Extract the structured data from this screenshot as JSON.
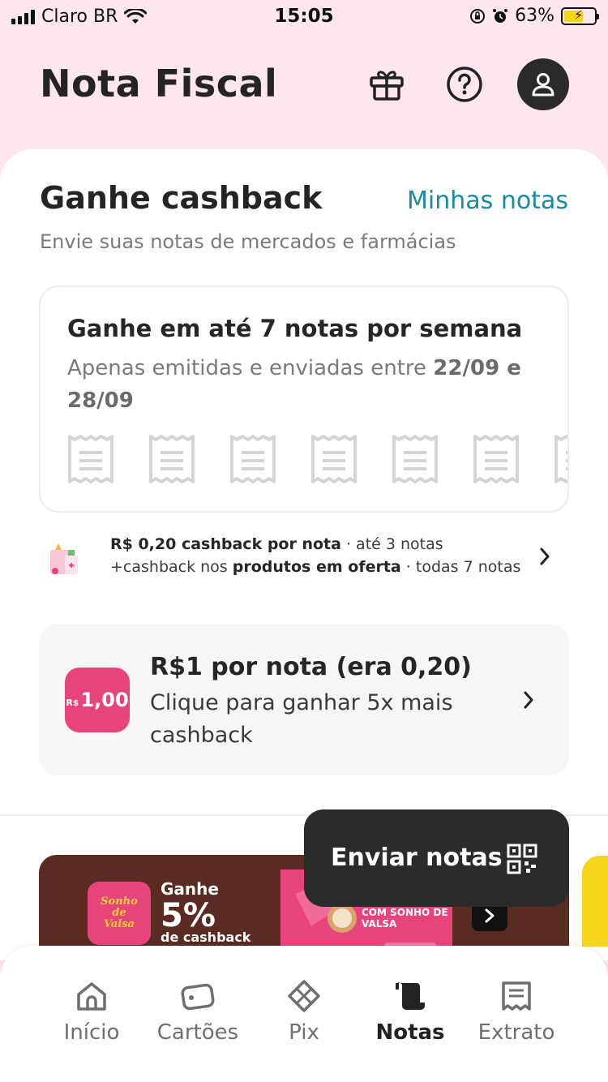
{
  "status_bar": {
    "carrier": "Claro BR",
    "time": "15:05",
    "battery": "63%",
    "battery_level": 0.63
  },
  "header": {
    "title": "Nota Fiscal",
    "icons": [
      "gift-icon",
      "help-icon",
      "profile-icon"
    ]
  },
  "cashback": {
    "title": "Ganhe cashback",
    "link": "Minhas notas",
    "subtitle": "Envie suas notas de mercados e farmácias"
  },
  "notes_card": {
    "title": "Ganhe em até 7 notas por semana",
    "desc_prefix": "Apenas emitidas e enviadas entre ",
    "date_start": "22/09",
    "date_and": " e ",
    "date_end": "28/09",
    "receipt_count": 7
  },
  "promo_row": {
    "line1_bold": "R$ 0,20 cashback por nota",
    "line1_rest": " · até 3 notas",
    "line2_prefix": "+cashback nos ",
    "line2_bold": "produtos em oferta",
    "line2_rest": " · todas 7 notas"
  },
  "offer": {
    "badge_currency": "R$",
    "badge_amount": "1,00",
    "title": "R$1 por nota (era 0,20)",
    "desc": "Clique para ganhar 5x mais cashback"
  },
  "banner": {
    "logo_line1": "Sonho",
    "logo_line2": "de",
    "logo_line3": "Valsa",
    "ganhe": "Ganhe",
    "percent": "5%",
    "cashback": "de cashback",
    "product_text": "COM SONHO DE VALSA"
  },
  "fab": {
    "label": "Enviar notas",
    "icon": "qr-code-icon"
  },
  "bottom_nav": [
    {
      "label": "Início",
      "icon": "home-icon"
    },
    {
      "label": "Cartões",
      "icon": "card-icon"
    },
    {
      "label": "Pix",
      "icon": "pix-icon"
    },
    {
      "label": "Notas",
      "icon": "receipt-icon",
      "active": true
    },
    {
      "label": "Extrato",
      "icon": "statement-icon"
    }
  ],
  "colors": {
    "header_bg": "#fde6ef",
    "accent_pink": "#e8447c",
    "link_teal": "#1a8aa0",
    "fab_bg": "#2b2b2b"
  }
}
